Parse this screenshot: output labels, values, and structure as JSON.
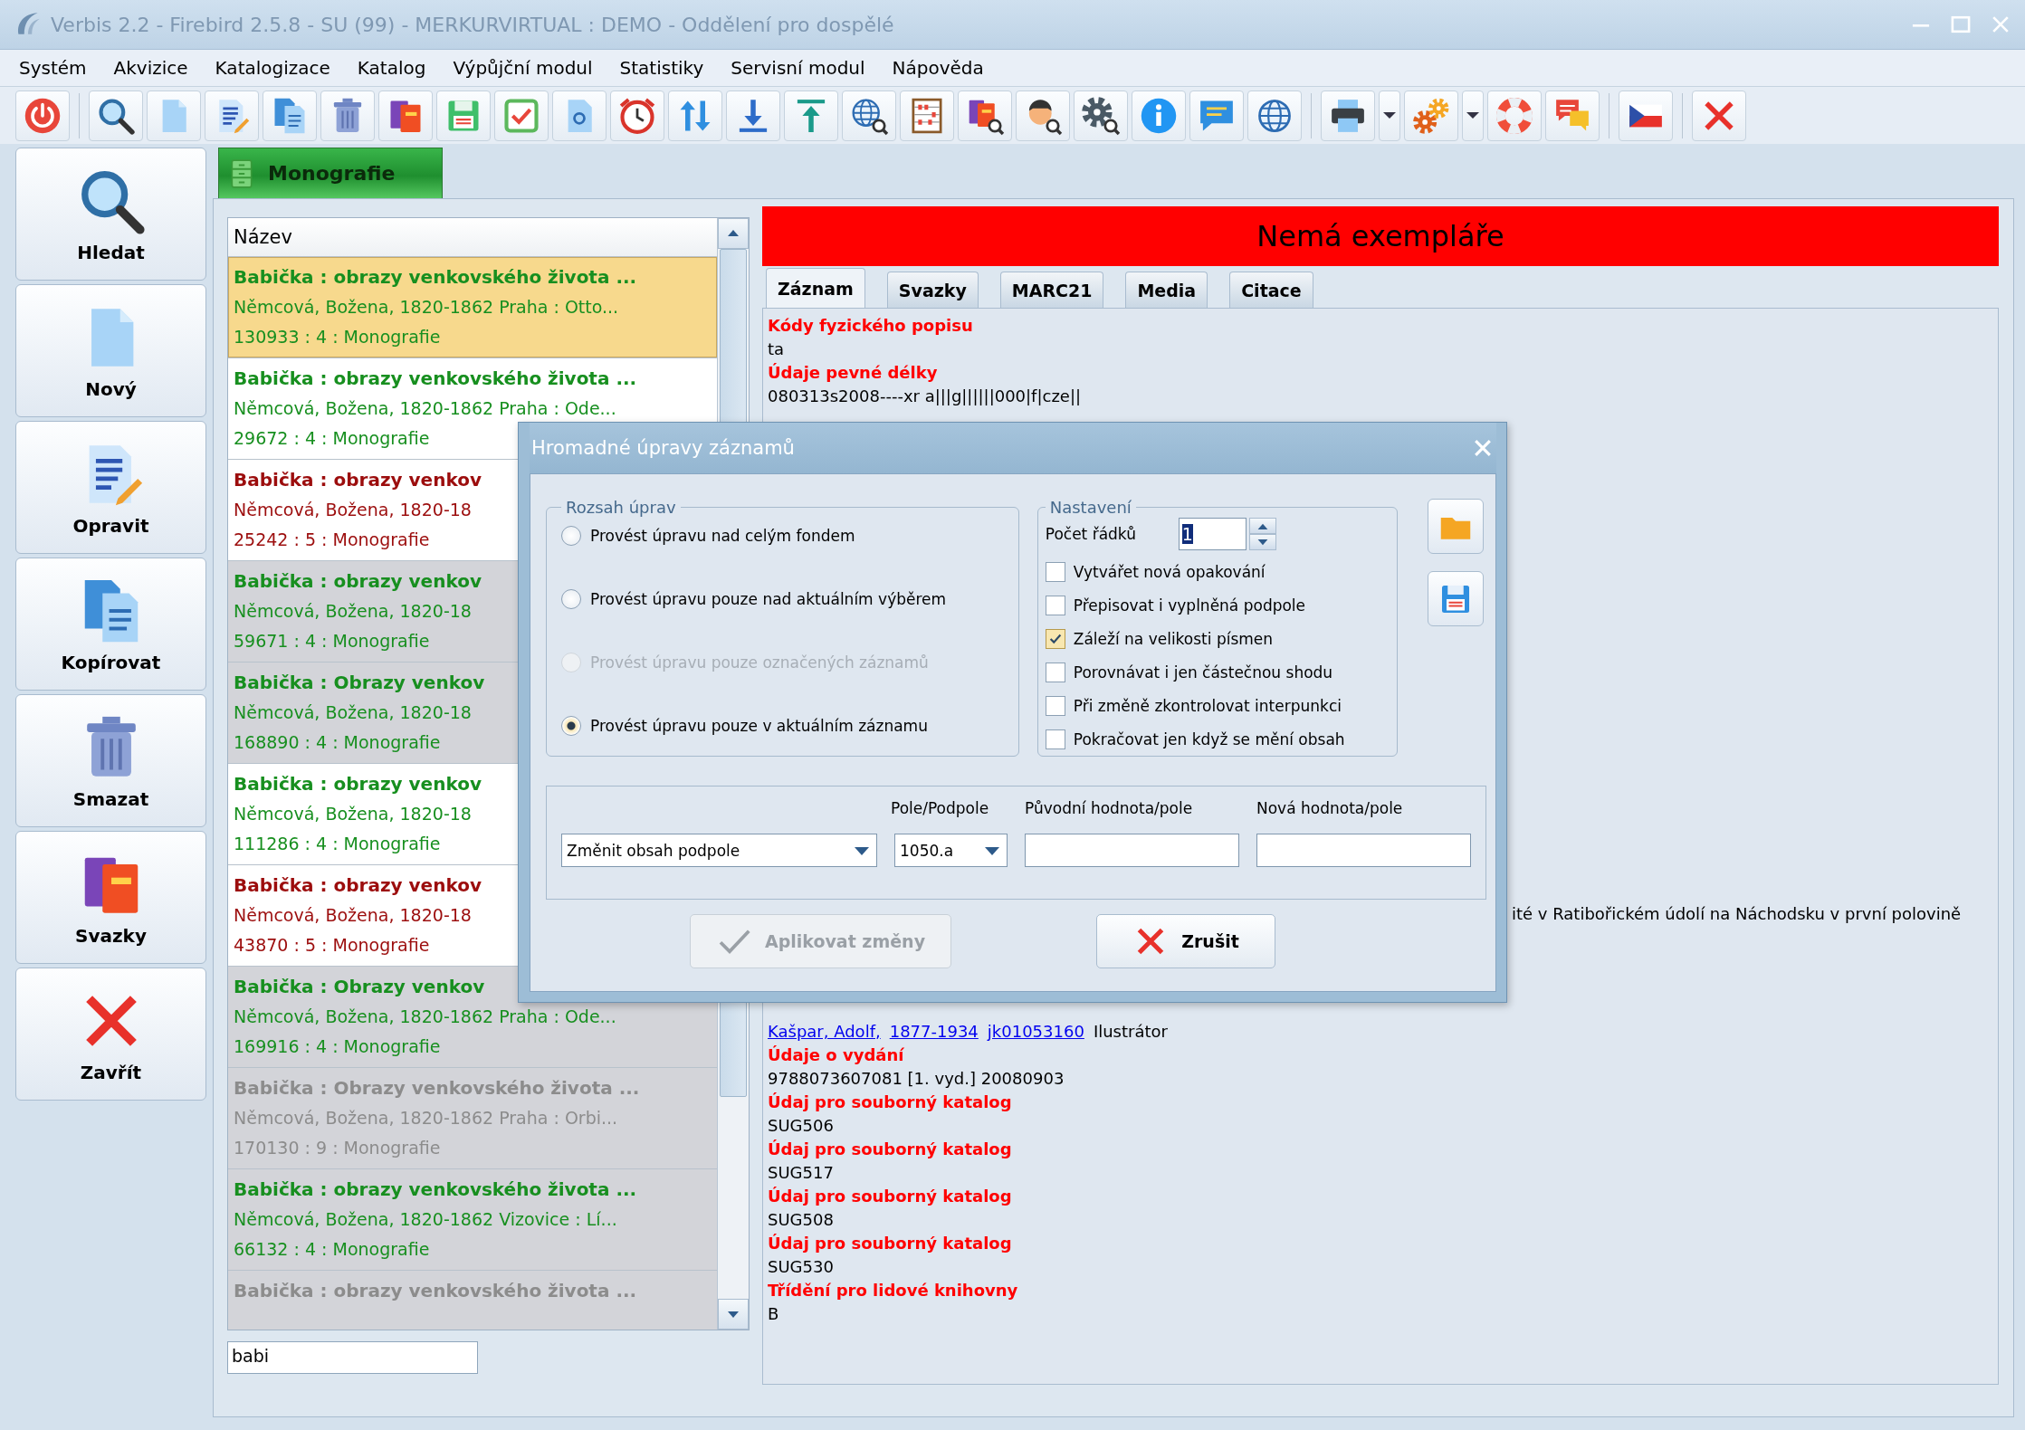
{
  "window": {
    "title": "Verbis 2.2 - Firebird 2.5.8 - SU (99) - MERKURVIRTUAL : DEMO - Oddělení pro dospělé"
  },
  "menu": [
    "Systém",
    "Akvizice",
    "Katalogizace",
    "Katalog",
    "Výpůjční modul",
    "Statistiky",
    "Servisní modul",
    "Nápověda"
  ],
  "side_buttons": [
    "Hledat",
    "Nový",
    "Opravit",
    "Kopírovat",
    "Smazat",
    "Svazky",
    "Zavřít"
  ],
  "document_tab": {
    "label": "Monografie"
  },
  "list": {
    "column": "Název",
    "rows": [
      {
        "lines": [
          "Babička : obrazy venkovského života ...",
          "Němcová, Božena, 1820-1862 Praha : Otto...",
          "130933 : 4 : Monografie"
        ],
        "color": "#178f1f",
        "shaded": false,
        "selected": true
      },
      {
        "lines": [
          "Babička : obrazy venkovského života ...",
          "Němcová, Božena, 1820-1862 Praha : Ode...",
          "29672 : 4 : Monografie"
        ],
        "color": "#178f1f",
        "shaded": false,
        "selected": false
      },
      {
        "lines": [
          "Babička : obrazy venkov",
          "Němcová, Božena, 1820-18",
          "25242 : 5 : Monografie"
        ],
        "color": "#9c0d0d",
        "shaded": false,
        "selected": false
      },
      {
        "lines": [
          "Babička : obrazy venkov",
          "Němcová, Božena, 1820-18",
          "59671 : 4 : Monografie"
        ],
        "color": "#178f1f",
        "shaded": true,
        "selected": false
      },
      {
        "lines": [
          "Babička : Obrazy venkov",
          "Němcová, Božena, 1820-18",
          "168890 : 4 : Monografie"
        ],
        "color": "#178f1f",
        "shaded": true,
        "selected": false
      },
      {
        "lines": [
          "Babička : obrazy venkov",
          "Němcová, Božena, 1820-18",
          "111286 : 4 : Monografie"
        ],
        "color": "#178f1f",
        "shaded": false,
        "selected": false
      },
      {
        "lines": [
          "Babička : obrazy venkov",
          "Němcová, Božena, 1820-18",
          "43870 : 5 : Monografie"
        ],
        "color": "#9c0d0d",
        "shaded": false,
        "selected": false
      },
      {
        "lines": [
          "Babička : Obrazy venkov",
          "Němcová, Božena, 1820-1862 Praha : Ode...",
          "169916 : 4 : Monografie"
        ],
        "color": "#178f1f",
        "shaded": true,
        "selected": false
      },
      {
        "lines": [
          "Babička : Obrazy venkovského života ...",
          "Němcová, Božena, 1820-1862 Praha : Orbi...",
          "170130 : 9 : Monografie"
        ],
        "color": "#8c8c8c",
        "shaded": true,
        "selected": false
      },
      {
        "lines": [
          "Babička : obrazy venkovského života ...",
          "Němcová, Božena, 1820-1862 Vizovice : Lí...",
          "66132 : 4 : Monografie"
        ],
        "color": "#178f1f",
        "shaded": true,
        "selected": false
      },
      {
        "lines": [
          "Babička : obrazy venkovského života ..."
        ],
        "color": "#8c8c8c",
        "shaded": true,
        "selected": false
      }
    ],
    "search": {
      "value": "babi"
    }
  },
  "record": {
    "banner": "Nemá exempláře",
    "tabs": [
      {
        "label": "Záznam",
        "selected": true
      },
      {
        "label": "Svazky",
        "selected": false
      },
      {
        "label": "MARC21",
        "selected": false
      },
      {
        "label": "Media",
        "selected": false
      },
      {
        "label": "Citace",
        "selected": false
      }
    ],
    "lines_top": [
      {
        "kind": "heading",
        "text": "Kódy fyzického popisu"
      },
      {
        "kind": "value",
        "text": "ta"
      },
      {
        "kind": "heading",
        "text": "Údaje pevné délky"
      },
      {
        "kind": "value",
        "text": "080313s2008----xr a|||g||||||000|f|cze||"
      }
    ],
    "continuation": "ité v Ratibořickém údolí na Náchodsku v první polovině",
    "lines_bottom": [
      {
        "kind": "links",
        "parts": [
          {
            "text": "Kašpar, Adolf,",
            "link": true
          },
          {
            "text": "1877-1934",
            "link": true
          },
          {
            "text": "jk01053160",
            "link": true
          },
          {
            "text": "Ilustrátor",
            "link": false
          }
        ]
      },
      {
        "kind": "heading",
        "text": "Údaje o vydání"
      },
      {
        "kind": "value",
        "text": "9788073607081  [1. vyd.]  20080903"
      },
      {
        "kind": "heading",
        "text": "Údaj pro souborný katalog"
      },
      {
        "kind": "value",
        "text": "SUG506"
      },
      {
        "kind": "heading",
        "text": "Údaj pro souborný katalog"
      },
      {
        "kind": "value",
        "text": "SUG517"
      },
      {
        "kind": "heading",
        "text": "Údaj pro souborný katalog"
      },
      {
        "kind": "value",
        "text": "SUG508"
      },
      {
        "kind": "heading",
        "text": "Údaj pro souborný katalog"
      },
      {
        "kind": "value",
        "text": "SUG530"
      },
      {
        "kind": "heading",
        "text": "Třídění pro lidové knihovny"
      },
      {
        "kind": "value",
        "text": "B"
      }
    ]
  },
  "dialog": {
    "title": "Hromadné úpravy záznamů",
    "scope": {
      "legend": "Rozsah úprav",
      "options": [
        {
          "label": "Provést úpravu nad celým fondem",
          "selected": false,
          "disabled": false
        },
        {
          "label": "Provést úpravu pouze nad aktuálním výběrem",
          "selected": false,
          "disabled": false
        },
        {
          "label": "Provést úpravu pouze označených záznamů",
          "selected": false,
          "disabled": true
        },
        {
          "label": "Provést úpravu pouze v aktuálním záznamu",
          "selected": true,
          "disabled": false
        }
      ]
    },
    "settings": {
      "legend": "Nastavení",
      "row_count_label": "Počet řádků",
      "row_count": "1",
      "options": [
        {
          "label": "Vytvářet nová opakování",
          "checked": false
        },
        {
          "label": "Přepisovat i vyplněná podpole",
          "checked": false
        },
        {
          "label": "Záleží na velikosti písmen",
          "checked": true
        },
        {
          "label": "Porovnávat i jen částečnou shodu",
          "checked": false
        },
        {
          "label": "Při změně zkontrolovat interpunkci",
          "checked": false
        },
        {
          "label": "Pokračovat jen když se mění obsah",
          "checked": false
        }
      ]
    },
    "operation": {
      "headers": [
        "Pole/Podpole",
        "Původní hodnota/pole",
        "Nová hodnota/pole"
      ],
      "action": "Změnit obsah podpole",
      "field": "1050.a"
    },
    "buttons": [
      {
        "kind": "apply",
        "label": "Aplikovat změny",
        "disabled": true
      },
      {
        "kind": "cancel",
        "label": "Zrušit",
        "disabled": false
      }
    ]
  }
}
